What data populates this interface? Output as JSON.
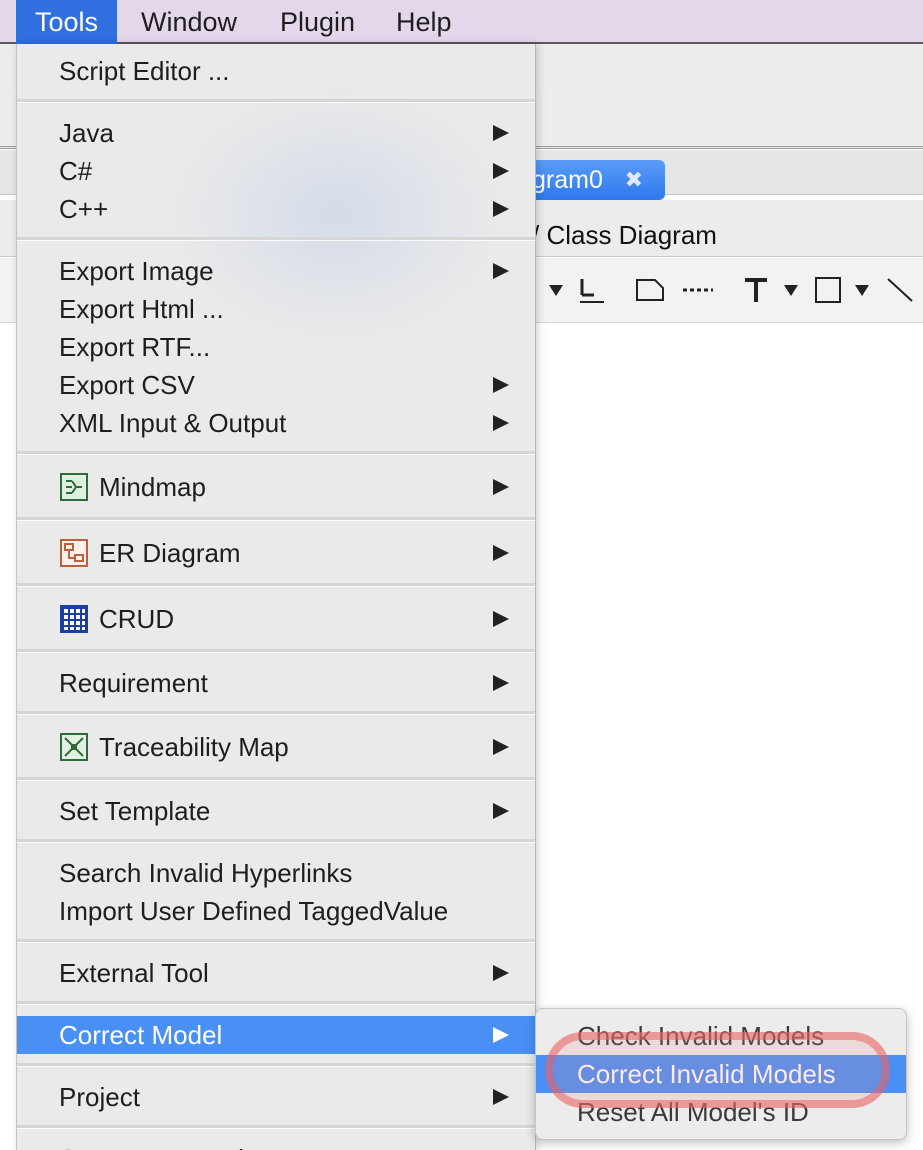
{
  "menubar": {
    "items": [
      {
        "label": "Tools",
        "active": true
      },
      {
        "label": "Window",
        "active": false
      },
      {
        "label": "Plugin",
        "active": false
      },
      {
        "label": "Help",
        "active": false
      }
    ]
  },
  "background": {
    "tab_label": "gram0",
    "tab_close": "✖",
    "breadcrumb": "/ Class Diagram"
  },
  "dropdown": {
    "items": [
      {
        "label": "Script Editor ...",
        "submenu": false
      },
      {
        "label": "Java",
        "submenu": true
      },
      {
        "label": "C#",
        "submenu": true
      },
      {
        "label": "C++",
        "submenu": true
      },
      {
        "label": "Export Image",
        "submenu": true
      },
      {
        "label": "Export Html ...",
        "submenu": false
      },
      {
        "label": "Export RTF...",
        "submenu": false
      },
      {
        "label": "Export CSV",
        "submenu": true
      },
      {
        "label": "XML Input & Output",
        "submenu": true
      },
      {
        "label": "Mindmap",
        "submenu": true,
        "icon": "mindmap-icon"
      },
      {
        "label": "ER Diagram",
        "submenu": true,
        "icon": "er-diagram-icon"
      },
      {
        "label": "CRUD",
        "submenu": true,
        "icon": "crud-grid-icon"
      },
      {
        "label": "Requirement",
        "submenu": true
      },
      {
        "label": "Traceability Map",
        "submenu": true,
        "icon": "traceability-map-icon"
      },
      {
        "label": "Set Template",
        "submenu": true
      },
      {
        "label": "Search Invalid Hyperlinks",
        "submenu": false
      },
      {
        "label": "Import User Defined TaggedValue",
        "submenu": false
      },
      {
        "label": "External Tool",
        "submenu": true
      },
      {
        "label": "Correct Model",
        "submenu": true,
        "highlighted": true
      },
      {
        "label": "Project",
        "submenu": true
      },
      {
        "label": "System Properties",
        "submenu": false
      }
    ]
  },
  "submenu": {
    "items": [
      {
        "label": "Check Invalid Models",
        "highlighted": false
      },
      {
        "label": "Correct Invalid Models",
        "highlighted": true
      },
      {
        "label": "Reset All Model's ID",
        "highlighted": false
      }
    ]
  },
  "colors": {
    "menubar_bg": "#e4d7ea",
    "selection_blue": "#4a8ff4",
    "annotation_ring": "#e86060"
  }
}
